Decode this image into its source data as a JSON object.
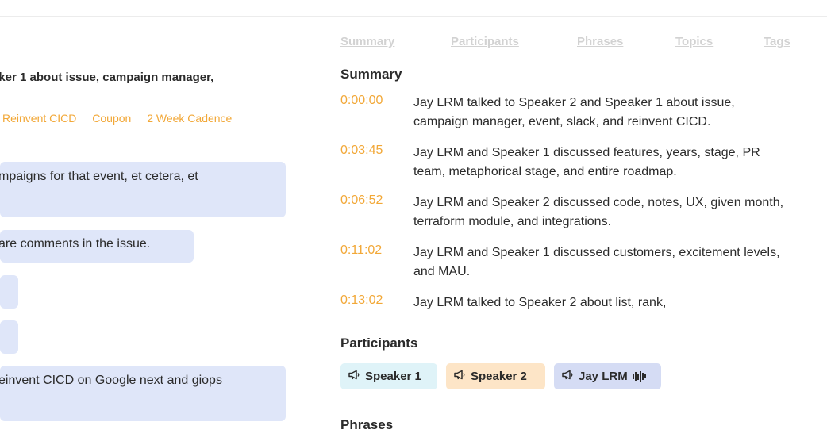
{
  "left": {
    "title": "aker 1 about issue, campaign manager,",
    "tags": [
      "Reinvent CICD",
      "Coupon",
      "2 Week Cadence"
    ],
    "messages": [
      "mpaigns for that event, et cetera, et",
      "are comments in the issue.",
      "",
      "",
      "einvent CICD on Google next and giops"
    ]
  },
  "tabs": [
    "Summary",
    "Participants",
    "Phrases",
    "Topics",
    "Tags"
  ],
  "summary": {
    "heading": "Summary",
    "items": [
      {
        "time": "0:00:00",
        "text": "Jay LRM talked to Speaker 2 and Speaker 1 about issue, campaign manager, event, slack, and reinvent CICD."
      },
      {
        "time": "0:03:45",
        "text": "Jay LRM and Speaker 1 discussed features, years, stage, PR team, metaphorical stage, and entire roadmap."
      },
      {
        "time": "0:06:52",
        "text": "Jay LRM and Speaker 2 discussed code, notes, UX, given month, terraform module, and integrations."
      },
      {
        "time": "0:11:02",
        "text": "Jay LRM and Speaker 1 discussed customers, excitement levels, and MAU."
      },
      {
        "time": "0:13:02",
        "text": "Jay LRM talked to Speaker 2 about list, rank,"
      }
    ]
  },
  "participants": {
    "heading": "Participants",
    "chips": [
      {
        "label": "Speaker 1",
        "color": "#dff3f8"
      },
      {
        "label": "Speaker 2",
        "color": "#fde5c7"
      },
      {
        "label": "Jay LRM",
        "color": "#d5dcf4"
      }
    ]
  },
  "phrases": {
    "heading": "Phrases"
  },
  "colors": {
    "accent": "#f2a838",
    "bubble": "#dfe6f9"
  }
}
